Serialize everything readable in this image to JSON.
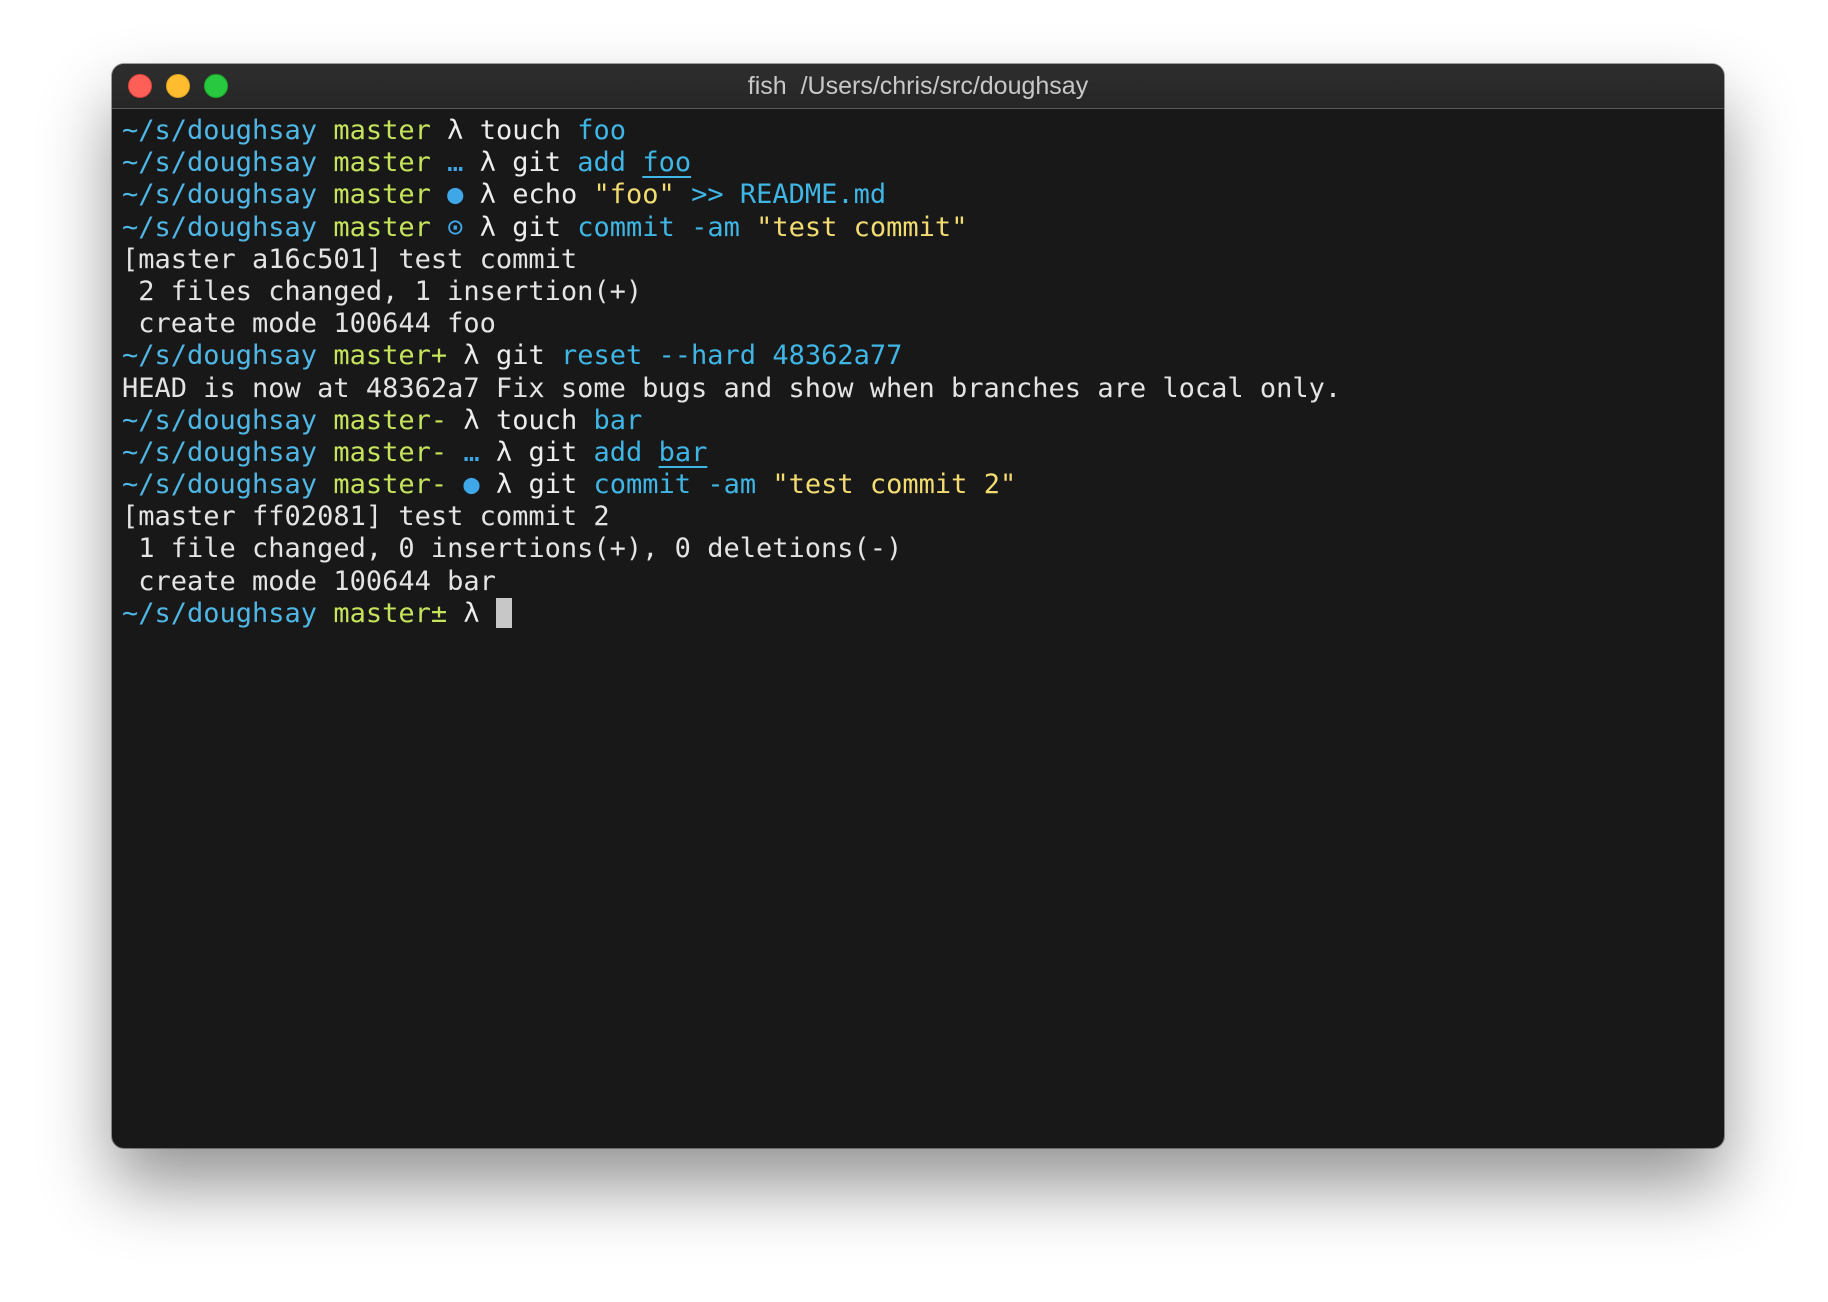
{
  "window": {
    "title": "fish  /Users/chris/src/doughsay",
    "buttons": {
      "close": "close",
      "minimize": "minimize",
      "zoom": "zoom"
    }
  },
  "colors": {
    "path": "#4fb7e6",
    "branch": "#c5e35b",
    "string": "#f2dc72",
    "argument": "#3fb6e5",
    "background": "#181818"
  },
  "terminal": {
    "lines": [
      {
        "type": "prompt",
        "path": "~/s/doughsay",
        "branch": "master",
        "status": "",
        "lambda": "λ",
        "command": "touch",
        "args": [
          {
            "t": "foo",
            "k": "arg"
          }
        ]
      },
      {
        "type": "prompt",
        "path": "~/s/doughsay",
        "branch": "master",
        "status": "…",
        "lambda": "λ",
        "command": "git",
        "args": [
          {
            "t": "add",
            "k": "arg"
          },
          {
            "t": "foo",
            "k": "argu"
          }
        ]
      },
      {
        "type": "prompt",
        "path": "~/s/doughsay",
        "branch": "master",
        "status": "●",
        "lambda": "λ",
        "command": "echo",
        "args": [
          {
            "t": "\"foo\"",
            "k": "str"
          },
          {
            "t": ">>",
            "k": "op"
          },
          {
            "t": "README.md",
            "k": "arg"
          }
        ]
      },
      {
        "type": "prompt",
        "path": "~/s/doughsay",
        "branch": "master",
        "status": "⊙",
        "lambda": "λ",
        "command": "git",
        "args": [
          {
            "t": "commit",
            "k": "arg"
          },
          {
            "t": "-am",
            "k": "arg"
          },
          {
            "t": "\"test commit\"",
            "k": "str"
          }
        ]
      },
      {
        "type": "output",
        "text": "[master a16c501] test commit"
      },
      {
        "type": "output",
        "text": " 2 files changed, 1 insertion(+)"
      },
      {
        "type": "output",
        "text": " create mode 100644 foo"
      },
      {
        "type": "prompt",
        "path": "~/s/doughsay",
        "branch": "master+",
        "status": "",
        "lambda": "λ",
        "command": "git",
        "args": [
          {
            "t": "reset",
            "k": "arg"
          },
          {
            "t": "--hard",
            "k": "arg"
          },
          {
            "t": "48362a77",
            "k": "arg"
          }
        ]
      },
      {
        "type": "output",
        "text": "HEAD is now at 48362a7 Fix some bugs and show when branches are local only."
      },
      {
        "type": "prompt",
        "path": "~/s/doughsay",
        "branch": "master-",
        "status": "",
        "lambda": "λ",
        "command": "touch",
        "args": [
          {
            "t": "bar",
            "k": "arg"
          }
        ]
      },
      {
        "type": "prompt",
        "path": "~/s/doughsay",
        "branch": "master-",
        "status": "…",
        "lambda": "λ",
        "command": "git",
        "args": [
          {
            "t": "add",
            "k": "arg"
          },
          {
            "t": "bar",
            "k": "argu"
          }
        ]
      },
      {
        "type": "prompt",
        "path": "~/s/doughsay",
        "branch": "master-",
        "status": "●",
        "lambda": "λ",
        "command": "git",
        "args": [
          {
            "t": "commit",
            "k": "arg"
          },
          {
            "t": "-am",
            "k": "arg"
          },
          {
            "t": "\"test commit 2\"",
            "k": "str"
          }
        ]
      },
      {
        "type": "output",
        "text": "[master ff02081] test commit 2"
      },
      {
        "type": "output",
        "text": " 1 file changed, 0 insertions(+), 0 deletions(-)"
      },
      {
        "type": "output",
        "text": " create mode 100644 bar"
      },
      {
        "type": "prompt",
        "path": "~/s/doughsay",
        "branch": "master±",
        "status": "",
        "lambda": "λ",
        "command": "",
        "args": [],
        "cursor": true
      }
    ]
  }
}
